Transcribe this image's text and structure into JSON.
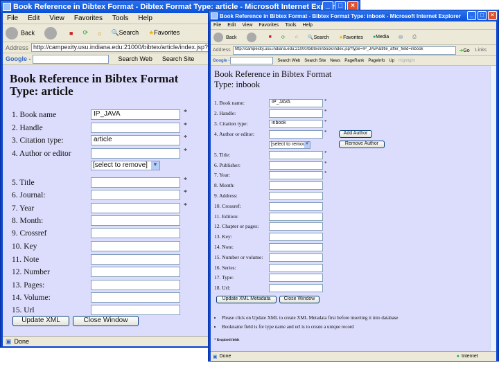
{
  "left_window": {
    "title": "Book Reference in Dibtex Format - Dibtex Format Type: article - Microsoft Internet Explorer",
    "menu": [
      "File",
      "Edit",
      "View",
      "Favorites",
      "Tools",
      "Help"
    ],
    "toolbar": [
      "Back",
      "Search",
      "Favorites"
    ],
    "address_label": "Address",
    "address": "http://campexity.usu.indiana.edu:21000/bibtex/article/index.jsp?u",
    "google_label": "Google -",
    "google_buttons": [
      "Search Web",
      "Search Site"
    ],
    "heading": "Book Reference in Bibtex Format",
    "subheading": "Type: article",
    "fields": [
      {
        "label": "1. Book name",
        "value": "IP_JAVA",
        "required": "*"
      },
      {
        "label": "2. Handle",
        "value": "",
        "required": "*"
      },
      {
        "label": "3. Citation type:",
        "value": "article",
        "required": "*"
      },
      {
        "label": "4. Author or editor",
        "value": "",
        "required": "*"
      },
      {
        "label": "5. Title",
        "value": "",
        "required": "*"
      },
      {
        "label": "6. Journal:",
        "value": "",
        "required": "*"
      },
      {
        "label": "7. Year",
        "value": "",
        "required": "*"
      },
      {
        "label": "8. Month:",
        "value": "",
        "required": ""
      },
      {
        "label": "9. Crossref",
        "value": "",
        "required": ""
      },
      {
        "label": "10. Key",
        "value": "",
        "required": ""
      },
      {
        "label": "11. Note",
        "value": "",
        "required": ""
      },
      {
        "label": "12. Number",
        "value": "",
        "required": ""
      },
      {
        "label": "13. Pages:",
        "value": "",
        "required": ""
      },
      {
        "label": "14. Volume:",
        "value": "",
        "required": ""
      },
      {
        "label": "15. Url",
        "value": "",
        "required": ""
      }
    ],
    "author_select": "[select to remove]",
    "update_button": "Update XML",
    "close_button": "Close Window",
    "status": "Done"
  },
  "right_window": {
    "title": "Book Reference in Bibtex Format - Bibtex Format Type: inbook - Microsoft Internet Explorer",
    "menu": [
      "File",
      "Edit",
      "View",
      "Favorites",
      "Tools",
      "Help"
    ],
    "toolbar": [
      "Back",
      "Search",
      "Favorites",
      "Media"
    ],
    "address_label": "Address",
    "address": "http://campexity.usu.indiana.edu:21000/bibtex/inbook/index.jsp?type=IP_JAVA&title_after_field=inbook",
    "go_label": "Go",
    "links_label": "Links",
    "google_label": "Google -",
    "google_buttons": [
      "Search Web",
      "Search Site",
      "News",
      "PageRank",
      "PageInfo",
      "Up",
      "Highlight"
    ],
    "heading": "Book Reference in Bibtex Format",
    "subheading": "Type: inbook",
    "fields": [
      {
        "label": "1. Book name:",
        "value": "IP_JAVA",
        "required": "*"
      },
      {
        "label": "2. Handle:",
        "value": "",
        "required": "*"
      },
      {
        "label": "3. Citation type:",
        "value": "inbook",
        "required": "*"
      },
      {
        "label": "4. Author or editor:",
        "value": "",
        "required": "*"
      },
      {
        "label": "5. Title:",
        "value": "",
        "required": "*"
      },
      {
        "label": "6. Publisher:",
        "value": "",
        "required": "*"
      },
      {
        "label": "7. Year:",
        "value": "",
        "required": "*"
      },
      {
        "label": "8. Month:",
        "value": "",
        "required": ""
      },
      {
        "label": "9. Address:",
        "value": "",
        "required": ""
      },
      {
        "label": "10. Crossref:",
        "value": "",
        "required": ""
      },
      {
        "label": "11. Edition:",
        "value": "",
        "required": ""
      },
      {
        "label": "12. Chapter or pages:",
        "value": "",
        "required": ""
      },
      {
        "label": "13. Key:",
        "value": "",
        "required": ""
      },
      {
        "label": "14. Note:",
        "value": "",
        "required": ""
      },
      {
        "label": "15. Number or volume:",
        "value": "",
        "required": ""
      },
      {
        "label": "16. Series:",
        "value": "",
        "required": ""
      },
      {
        "label": "17. Type:",
        "value": "",
        "required": ""
      },
      {
        "label": "18. Url:",
        "value": "",
        "required": ""
      }
    ],
    "author_select": "[select to remove]",
    "add_author": "Add Author",
    "remove_author": "Remove Author",
    "update_button": "Update XML Metadata",
    "close_button": "Close Window",
    "notes": [
      "Please click on Update XML to create XML Metadata first before inserting it into database",
      "Bookname field is for type name and url is to create a unique record"
    ],
    "required_note": "* Required fields",
    "status": "Done",
    "zone": "Internet"
  }
}
